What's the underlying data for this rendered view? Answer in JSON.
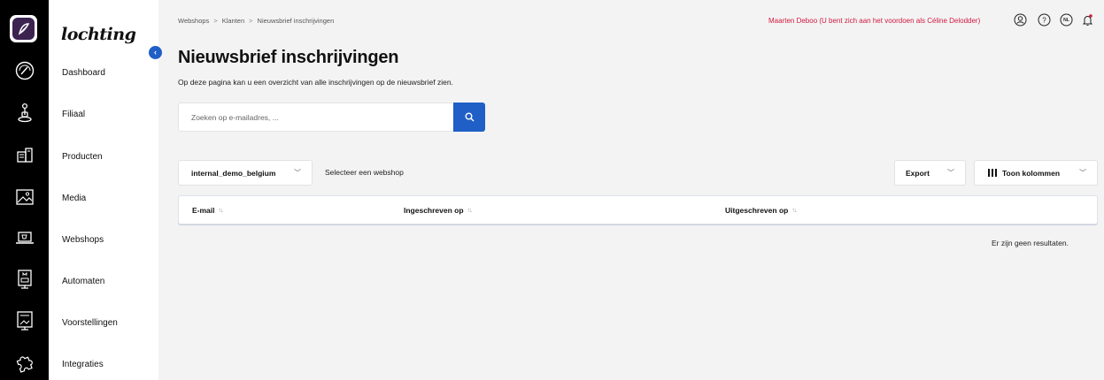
{
  "app": {
    "brand": "lochting"
  },
  "sidebar": {
    "items": [
      {
        "label": "Dashboard",
        "icon": "gauge-icon"
      },
      {
        "label": "Filiaal",
        "icon": "store-pin-icon"
      },
      {
        "label": "Producten",
        "icon": "products-icon"
      },
      {
        "label": "Media",
        "icon": "image-icon"
      },
      {
        "label": "Webshops",
        "icon": "laptop-cart-icon"
      },
      {
        "label": "Automaten",
        "icon": "vending-machine-icon"
      },
      {
        "label": "Voorstellingen",
        "icon": "presentation-icon"
      },
      {
        "label": "Integraties",
        "icon": "puzzle-icon"
      }
    ]
  },
  "header": {
    "breadcrumb": [
      "Webshops",
      "Klanten",
      "Nieuwsbrief inschrijvingen"
    ],
    "breadcrumb_sep": ">",
    "impersonation": "Maarten Deboo (U bent zich aan het voordoen als Céline Delodder)",
    "language": "NL"
  },
  "page": {
    "title": "Nieuwsbrief inschrijvingen",
    "subtitle": "Op deze pagina kan u een overzicht van alle inschrijvingen op de nieuwsbrief zien."
  },
  "search": {
    "placeholder": "Zoeken op e-mailadres, ..."
  },
  "controls": {
    "webshop_value": "internal_demo_belgium",
    "webshop_hint": "Selecteer een webshop",
    "export_label": "Export",
    "columns_label": "Toon kolommen"
  },
  "table": {
    "columns": [
      "E-mail",
      "Ingeschreven op",
      "Uitgeschreven op"
    ],
    "sort_glyph": "↑↓",
    "empty_text": "Er zijn geen resultaten."
  },
  "colors": {
    "accent": "#1f5fc6",
    "warning": "#d11a3d",
    "rail": "#000000"
  }
}
